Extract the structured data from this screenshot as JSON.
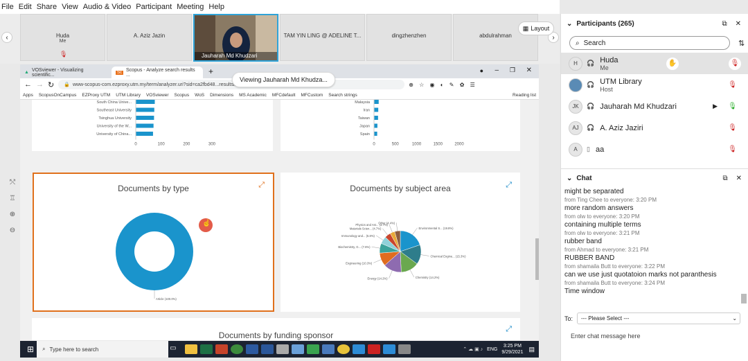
{
  "menu": [
    "File",
    "Edit",
    "Share",
    "View",
    "Audio & Video",
    "Participant",
    "Meeting",
    "Help"
  ],
  "gallery": {
    "tiles": [
      {
        "name": "Huda",
        "sub": "Me"
      },
      {
        "name": "A. Aziz Jazin",
        "sub": ""
      },
      {
        "name": "TAM YIN LING @ ADELINE T...",
        "sub": ""
      },
      {
        "name": "dingzhenzhen",
        "sub": ""
      },
      {
        "name": "abdulrahman",
        "sub": ""
      }
    ],
    "speaker_name": "Jauharah Md Khudzari",
    "layout_label": "Layout"
  },
  "tooltip": "Viewing Jauharah Md Khudza...",
  "browser": {
    "tabs": [
      "VOSviewer - Visualizing scientific...",
      "Scopus - Analyze search results ..."
    ],
    "url": "www-scopus-com.ezproxy.utm.my/term/analyzer.uri?sid=ca2fbd48...resultslist&src=s&s=TITLE-...",
    "bookmarks": [
      "Apps",
      "ScopusOnCampus",
      "EZProxy UTM",
      "UTM Library",
      "VOSviewer",
      "Scopus",
      "WoS",
      "Dimensions",
      "MS Academic",
      "MFCdefault",
      "MFCustom",
      "Search strings",
      "Reading list"
    ]
  },
  "chart_data": [
    {
      "type": "bar",
      "title": "",
      "categories": [
        "South China Unive...",
        "Southeast University",
        "Tsinghua University",
        "University of the W...",
        "University of China..."
      ],
      "values": [
        75,
        73,
        72,
        70,
        68
      ],
      "xlim": [
        0,
        300
      ],
      "xticks": [
        "0",
        "100",
        "200",
        "300"
      ]
    },
    {
      "type": "bar",
      "title": "",
      "categories": [
        "Malaysia",
        "Iran",
        "Taiwan",
        "Japan",
        "Spain"
      ],
      "values": [
        110,
        100,
        95,
        80,
        75
      ],
      "xlim": [
        0,
        2000
      ],
      "xticks": [
        "0",
        "500",
        "1000",
        "1500",
        "2000"
      ]
    },
    {
      "type": "pie",
      "title": "Documents by type",
      "categories": [
        "Article"
      ],
      "values": [
        100
      ],
      "slice_labels": [
        "Article (100.0%)"
      ],
      "colors": [
        "#1a94cc"
      ]
    },
    {
      "type": "pie",
      "title": "Documents by subject area",
      "categories": [
        "Environmental S...",
        "Chemical Engine...",
        "Chemistry",
        "Energy",
        "Engineering",
        "Biochemistry, G...",
        "Immunology and...",
        "Materials Scien...",
        "Physics and Ast...",
        "Other"
      ],
      "values": [
        19.8,
        15.3,
        14.2,
        14.2,
        10.3,
        7.6,
        5.8,
        4.7,
        3.7,
        4.4
      ],
      "slice_labels": [
        "Environmental S... (19.8%)",
        "Chemical Engine... (15.3%)",
        "Chemistry (14.2%)",
        "Energy (14.2%)",
        "Engineering (10.3%)",
        "Biochemistry, G... (7.6%)",
        "Immunology and... (5.8%)",
        "Materials Scien... (4.7%)",
        "Physics and Ast... (3.7%)",
        "Other (4.4%)"
      ],
      "colors": [
        "#1a94cc",
        "#2e7d8b",
        "#6aa84f",
        "#8e6bb0",
        "#e06c1f",
        "#3aa39b",
        "#8ed1d9",
        "#c9452d",
        "#e8a838",
        "#8d5d40"
      ]
    }
  ],
  "cards": {
    "funding_title": "Documents by funding sponsor"
  },
  "taskbar": {
    "search": "Type here to search",
    "lang": "ENG",
    "time": "3:25 PM",
    "date": "9/29/2021"
  },
  "participants": {
    "title": "Participants (265)",
    "search_placeholder": "Search",
    "list": [
      {
        "initials": "H",
        "name": "Huda",
        "sub": "Me"
      },
      {
        "initials": "",
        "name": "UTM Library",
        "sub": "Host"
      },
      {
        "initials": "JK",
        "name": "Jauharah Md Khudzari",
        "sub": ""
      },
      {
        "initials": "AJ",
        "name": "A. Aziz Jaziri",
        "sub": ""
      },
      {
        "initials": "A",
        "name": "aa",
        "sub": ""
      }
    ]
  },
  "chat": {
    "title": "Chat",
    "messages": [
      {
        "text": "might be separated",
        "from": "from Ting Chee to everyone:",
        "time": "3:20 PM"
      },
      {
        "text": "more random answers",
        "from": "from olw to everyone:",
        "time": "3:20 PM"
      },
      {
        "text": "containing multiple terms",
        "from": "from olw to everyone:",
        "time": "3:21 PM"
      },
      {
        "text": "rubber band",
        "from": "from Ahmad to everyone:",
        "time": "3:21 PM"
      },
      {
        "text": "RUBBER BAND",
        "from": "from shamaila Butt to everyone:",
        "time": "3:22 PM"
      },
      {
        "text": "can we use just quotatoion marks not paranthesis",
        "from": "from shamaila Butt to everyone:",
        "time": "3:24 PM"
      },
      {
        "text": "Time window",
        "from": "",
        "time": ""
      }
    ],
    "to_label": "To:",
    "to_value": "--- Please Select ---",
    "input_placeholder": "Enter chat message here"
  }
}
